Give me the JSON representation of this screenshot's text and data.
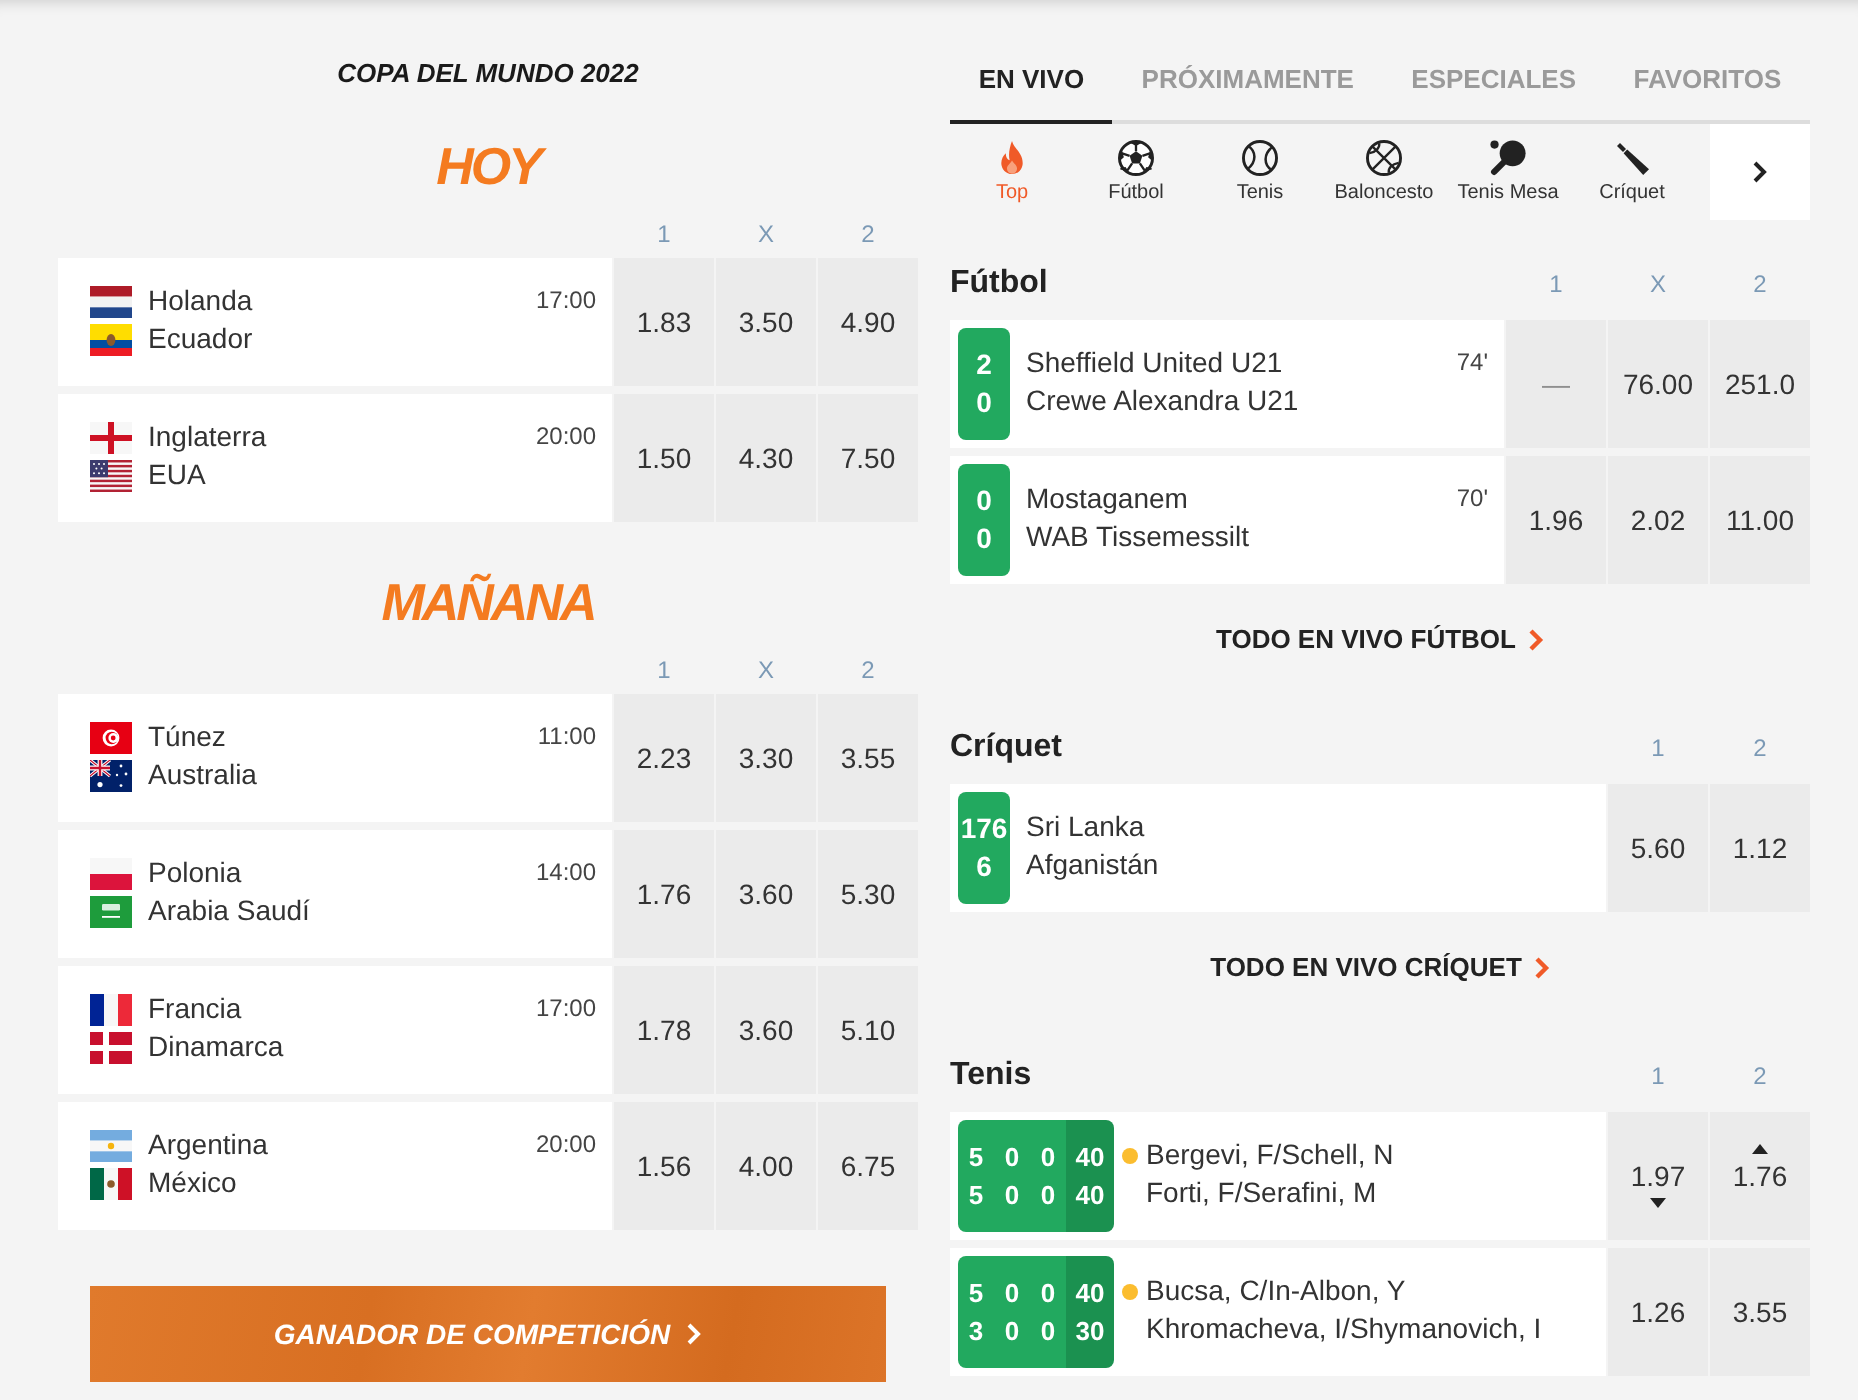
{
  "competition": {
    "title": "COPA DEL MUNDO 2022",
    "groups": [
      {
        "heading": "HOY",
        "columns": [
          "1",
          "X",
          "2"
        ],
        "matches": [
          {
            "teams": [
              {
                "name": "Holanda",
                "kind": "nl"
              },
              {
                "name": "Ecuador",
                "kind": "ec"
              }
            ],
            "time": "17:00",
            "odds": [
              "1.83",
              "3.50",
              "4.90"
            ]
          },
          {
            "teams": [
              {
                "name": "Inglaterra",
                "kind": "en"
              },
              {
                "name": "EUA",
                "kind": "us"
              }
            ],
            "time": "20:00",
            "odds": [
              "1.50",
              "4.30",
              "7.50"
            ]
          }
        ]
      },
      {
        "heading": "MAÑANA",
        "columns": [
          "1",
          "X",
          "2"
        ],
        "matches": [
          {
            "teams": [
              {
                "name": "Túnez",
                "kind": "tn"
              },
              {
                "name": "Australia",
                "kind": "au"
              }
            ],
            "time": "11:00",
            "odds": [
              "2.23",
              "3.30",
              "3.55"
            ]
          },
          {
            "teams": [
              {
                "name": "Polonia",
                "kind": "pl"
              },
              {
                "name": "Arabia Saudí",
                "kind": "sa"
              }
            ],
            "time": "14:00",
            "odds": [
              "1.76",
              "3.60",
              "5.30"
            ]
          },
          {
            "teams": [
              {
                "name": "Francia",
                "kind": "fr"
              },
              {
                "name": "Dinamarca",
                "kind": "dk"
              }
            ],
            "time": "17:00",
            "odds": [
              "1.78",
              "3.60",
              "5.10"
            ]
          },
          {
            "teams": [
              {
                "name": "Argentina",
                "kind": "ar"
              },
              {
                "name": "México",
                "kind": "mx"
              }
            ],
            "time": "20:00",
            "odds": [
              "1.56",
              "4.00",
              "6.75"
            ]
          }
        ]
      }
    ],
    "button": "GANADOR DE COMPETICIÓN"
  },
  "tabs": [
    {
      "label": "EN VIVO",
      "selected": true
    },
    {
      "label": "PRÓXIMAMENTE",
      "selected": false
    },
    {
      "label": "ESPECIALES",
      "selected": false
    },
    {
      "label": "FAVORITOS",
      "selected": false
    }
  ],
  "sports": [
    {
      "label": "Top",
      "kind": "top",
      "selected": true
    },
    {
      "label": "Fútbol",
      "kind": "soccer",
      "selected": false
    },
    {
      "label": "Tenis",
      "kind": "tennis",
      "selected": false
    },
    {
      "label": "Baloncesto",
      "kind": "basketball",
      "selected": false
    },
    {
      "label": "Tenis Mesa",
      "kind": "pingpong",
      "selected": false
    },
    {
      "label": "Críquet",
      "kind": "cricket",
      "selected": false
    }
  ],
  "sections": [
    {
      "title": "Fútbol",
      "kind": "football",
      "columns": [
        "1",
        "X",
        "2"
      ],
      "events": [
        {
          "score": [
            "2",
            "0"
          ],
          "teams": [
            {
              "name": "Sheffield United U21"
            },
            {
              "name": "Crewe Alexandra U21"
            }
          ],
          "minute": "74'",
          "odds": [
            {
              "value": "—",
              "disabled": true
            },
            {
              "value": "76.00",
              "disabled": false
            },
            {
              "value": "251.0",
              "disabled": false
            }
          ]
        },
        {
          "score": [
            "0",
            "0"
          ],
          "teams": [
            {
              "name": "Mostaganem"
            },
            {
              "name": "WAB Tissemessilt"
            }
          ],
          "minute": "70'",
          "odds": [
            {
              "value": "1.96",
              "disabled": false
            },
            {
              "value": "2.02",
              "disabled": false
            },
            {
              "value": "11.00",
              "disabled": false
            }
          ]
        }
      ],
      "more_link": "TODO EN VIVO FÚTBOL"
    },
    {
      "title": "Críquet",
      "kind": "cricket",
      "columns": [
        "1",
        "2"
      ],
      "events": [
        {
          "score": [
            "176",
            "6"
          ],
          "teams": [
            {
              "name": "Sri Lanka"
            },
            {
              "name": "Afganistán"
            }
          ],
          "odds": [
            {
              "value": "5.60"
            },
            {
              "value": "1.12"
            }
          ]
        }
      ],
      "more_link": "TODO EN VIVO CRÍQUET"
    },
    {
      "title": "Tenis",
      "kind": "tennis",
      "columns": [
        "1",
        "2"
      ],
      "events": [
        {
          "score": [
            {
              "games": [
                "5",
                "0",
                "0"
              ],
              "points": "40"
            },
            {
              "games": [
                "5",
                "0",
                "0"
              ],
              "points": "40"
            }
          ],
          "teams": [
            {
              "name": "Bergevi, F/Schell, N",
              "serving": true
            },
            {
              "name": "Forti, F/Serafini, M",
              "serving": false
            }
          ],
          "odds": [
            {
              "value": "1.97",
              "kind": "down"
            },
            {
              "value": "1.76",
              "kind": "up"
            }
          ]
        },
        {
          "score": [
            {
              "games": [
                "5",
                "0",
                "0"
              ],
              "points": "40"
            },
            {
              "games": [
                "3",
                "0",
                "0"
              ],
              "points": "30"
            }
          ],
          "teams": [
            {
              "name": "Bucsa, C/In-Albon, Y",
              "serving": true
            },
            {
              "name": "Khromacheva, I/Shymanovich, I",
              "serving": false
            }
          ],
          "odds": [
            {
              "value": "1.26",
              "kind": "plain"
            },
            {
              "value": "3.55",
              "kind": "plain"
            }
          ]
        }
      ]
    }
  ]
}
